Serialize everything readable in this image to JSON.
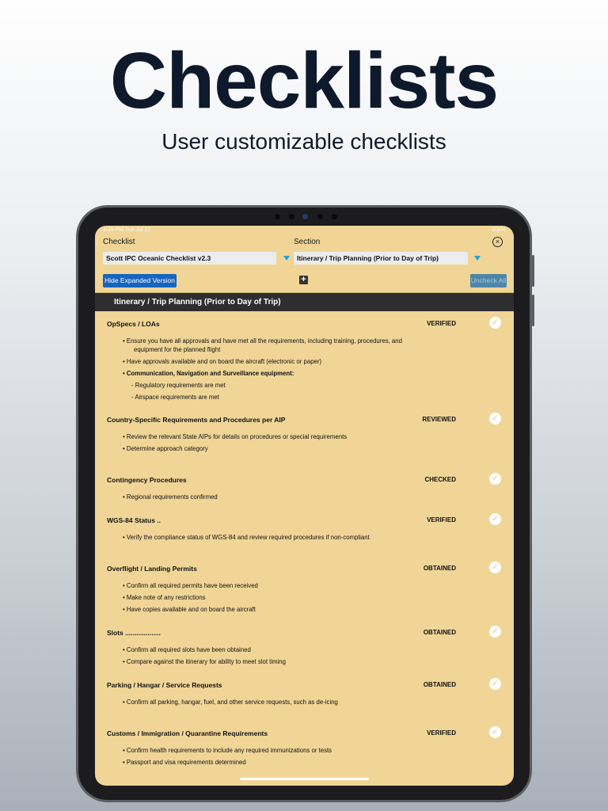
{
  "hero": {
    "title": "Checklists",
    "subtitle": "User customizable checklists"
  },
  "status_bar": {
    "time": "4:49 PM  Tue Jul 22",
    "battery": "100%"
  },
  "toolbar": {
    "checklist_label": "Checklist",
    "section_label": "Section",
    "checklist_value": "Scott IPC Oceanic Checklist v2.3",
    "section_value": "Itinerary / Trip Planning (Prior to Day of Trip)",
    "hide_button": "Hide Expanded Version",
    "add_button": "+",
    "uncheck_button": "Uncheck All"
  },
  "section_title": "Itinerary / Trip Planning (Prior to Day of Trip)",
  "items": [
    {
      "title": "OpSpecs / LOAs",
      "status": "VERIFIED",
      "bullets": [
        {
          "text": "• Ensure you have all approvals and have met all the requirements, including training, procedures, and",
          "indent": 0
        },
        {
          "text": "equipment for the planned flight",
          "indent": 1
        },
        {
          "text": "• Have approvals available and on board the aircraft (electronic or paper)",
          "indent": 0
        },
        {
          "text": "• Communication, Navigation and Surveillance equipment:",
          "indent": 0,
          "bold": true
        },
        {
          "text": "- Regulatory requirements are met",
          "indent": 2
        },
        {
          "text": "- Airspace requirements are met",
          "indent": 2
        }
      ]
    },
    {
      "title": "Country-Specific Requirements and Procedures per AIP",
      "status": "REVIEWED",
      "bullets": [
        {
          "text": "• Review the relevant State AIPs for details on procedures or special requirements",
          "indent": 0
        },
        {
          "text": "• Determine approach category",
          "indent": 0
        }
      ]
    },
    {
      "title": "Contingency Procedures",
      "status": "CHECKED",
      "bullets": [
        {
          "text": "• Regional requirements confirmed",
          "indent": 0
        }
      ]
    },
    {
      "title": "WGS-84 Status ..",
      "status": "VERIFIED",
      "bullets": [
        {
          "text": "• Verify the compliance status of WGS-84 and review required procedures if non-compliant",
          "indent": 0
        }
      ]
    },
    {
      "title": "Overflight / Landing Permits",
      "status": "OBTAINED",
      "bullets": [
        {
          "text": "• Confirm all required permits have been received",
          "indent": 0
        },
        {
          "text": "• Make note of any restrictions",
          "indent": 0
        },
        {
          "text": "• Have copies available and on board the aircraft",
          "indent": 0
        }
      ]
    },
    {
      "title": "Slots ...................",
      "status": "OBTAINED",
      "bullets": [
        {
          "text": "• Confirm all required slots have been obtained",
          "indent": 0
        },
        {
          "text": "• Compare against the itinerary for ability to meet slot timing",
          "indent": 0
        }
      ]
    },
    {
      "title": "Parking / Hangar / Service Requests",
      "status": "OBTAINED",
      "bullets": [
        {
          "text": "• Confirm all parking, hangar, fuel, and other service requests, such as de-icing",
          "indent": 0
        }
      ]
    },
    {
      "title": "Customs / Immigration / Quarantine Requirements",
      "status": "VERIFIED",
      "bullets": [
        {
          "text": "• Confirm health requirements to include any required immunizations or tests",
          "indent": 0
        },
        {
          "text": "• Passport and visa requirements determined",
          "indent": 0
        }
      ]
    }
  ],
  "colors": {
    "screen_bg": "#f0d597",
    "section_bar": "#2e2e31",
    "hide_button": "#1565c0",
    "uncheck_button": "#4d86a9",
    "dropdown_arrow": "#1fa3d6"
  }
}
